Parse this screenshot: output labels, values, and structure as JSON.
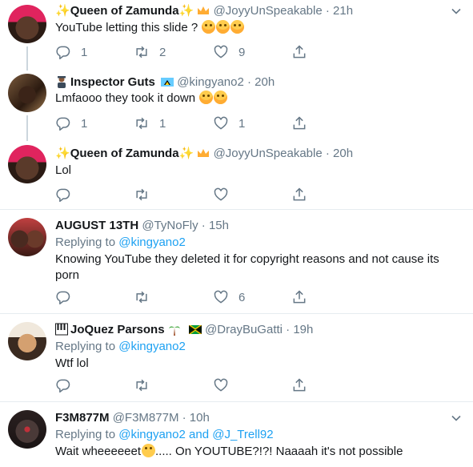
{
  "tweets": [
    {
      "name": "Queen of Zamunda",
      "handle": "@JoyyUnSpeakable",
      "sep": "·",
      "time": "21h",
      "text": "YouTube letting this slide ? ",
      "replies": "1",
      "retweets": "2",
      "likes": "9"
    },
    {
      "name": "Inspector Guts",
      "handle": "@kingyano2",
      "sep": "·",
      "time": "20h",
      "text": "Lmfaooo they took it down ",
      "replies": "1",
      "retweets": "1",
      "likes": "1"
    },
    {
      "name": "Queen of Zamunda",
      "handle": "@JoyyUnSpeakable",
      "sep": "·",
      "time": "20h",
      "text": "Lol",
      "replies": "",
      "retweets": "",
      "likes": ""
    },
    {
      "name": "AUGUST 13TH",
      "handle": "@TyNoFly",
      "sep": "·",
      "time": "15h",
      "replying_label": "Replying to ",
      "replying_to": "@kingyano2",
      "text": "Knowing YouTube they deleted it for copyright reasons and not cause its porn",
      "replies": "",
      "retweets": "",
      "likes": "6"
    },
    {
      "name": "JoQuez Parsons",
      "handle": "@DrayBuGatti",
      "sep": "·",
      "time": "19h",
      "replying_label": "Replying to ",
      "replying_to": "@kingyano2",
      "text": "Wtf lol",
      "replies": "",
      "retweets": "",
      "likes": ""
    },
    {
      "name": "F3M877M",
      "handle": "@F3M877M",
      "sep": "·",
      "time": "10h",
      "replying_label": "Replying to ",
      "replying_to": "@kingyano2",
      "replying_and": " and ",
      "replying_to_2": "@J_Trell92",
      "text_a": "Wait wheeeeeet",
      "text_b": "..... On YOUTUBE?!?! Naaaah it's not possible"
    }
  ],
  "icons": {
    "reply": "reply-icon",
    "retweet": "retweet-icon",
    "like": "heart-icon",
    "share": "share-icon",
    "more": "chevron-down-icon"
  },
  "colors": {
    "link": "#1da1f2",
    "muted": "#657786",
    "text": "#14171a",
    "divider": "#e6ecf0"
  }
}
